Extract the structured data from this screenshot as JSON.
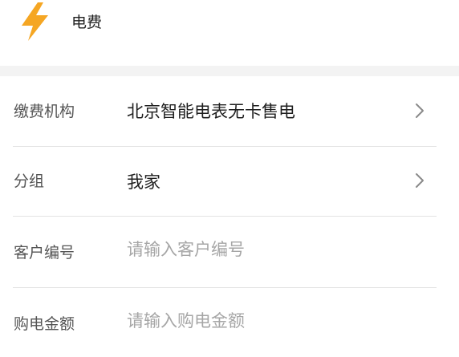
{
  "header": {
    "icon": "lightning-bolt-icon",
    "title": "电费",
    "accent_color": "#f5a623"
  },
  "form": {
    "rows": [
      {
        "label": "缴费机构",
        "value": "北京智能电表无卡售电",
        "action_icon": "chevron-right-icon"
      },
      {
        "label": "分组",
        "value": "我家",
        "action_icon": "chevron-right-icon"
      },
      {
        "label": "客户编号",
        "placeholder": "请输入客户编号"
      },
      {
        "label": "购电金额",
        "placeholder": "请输入购电金额"
      }
    ]
  }
}
